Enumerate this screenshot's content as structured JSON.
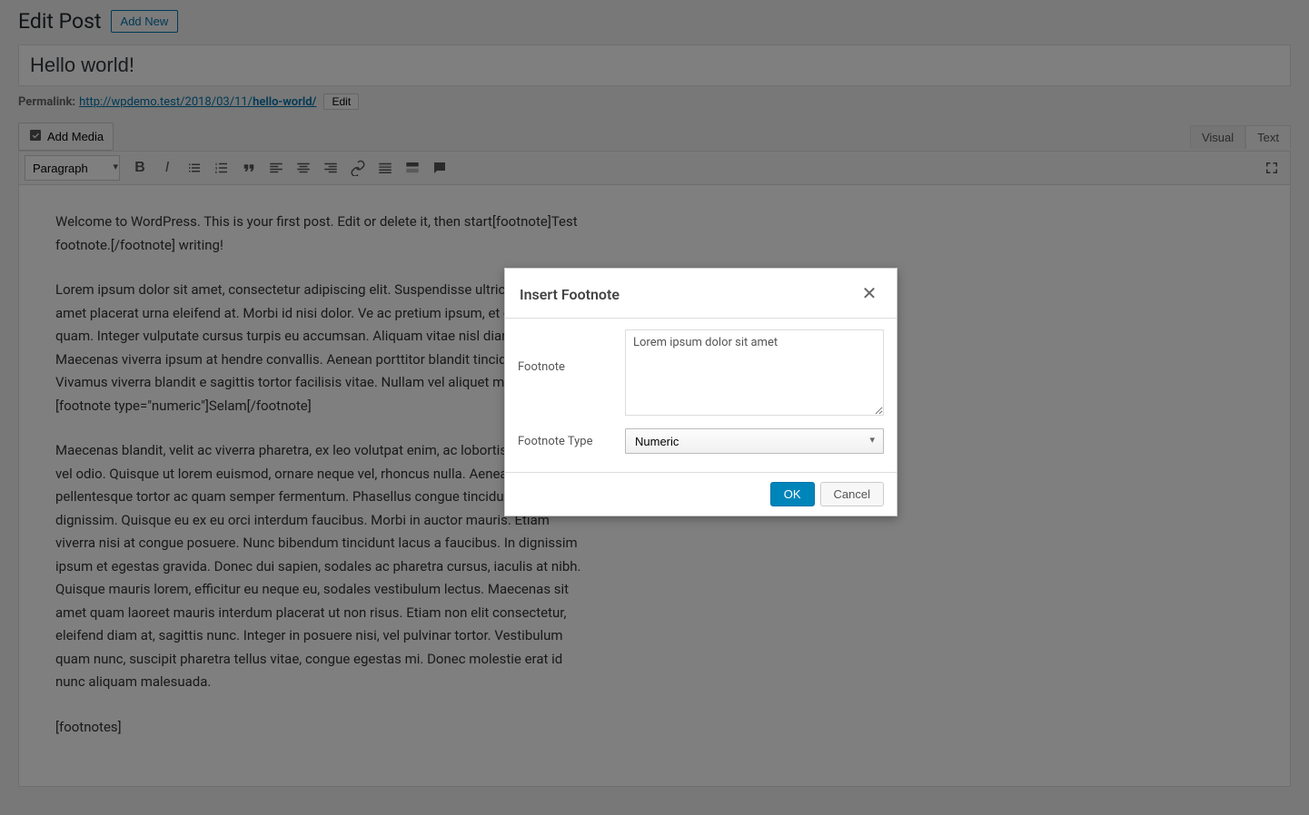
{
  "header": {
    "page_title": "Edit Post",
    "add_new_label": "Add New"
  },
  "post": {
    "title": "Hello world!",
    "permalink_label": "Permalink:",
    "permalink_base": "http://wpdemo.test/2018/03/11/",
    "permalink_slug": "hello-world/",
    "permalink_edit_label": "Edit"
  },
  "media": {
    "add_media_label": "Add Media"
  },
  "tabs": {
    "visual": "Visual",
    "text": "Text"
  },
  "toolbar": {
    "format_selected": "Paragraph"
  },
  "editor": {
    "p1": "Welcome to WordPress. This is your first post. Edit or delete it, then start[footnote]Test footnote.[/footnote] writing!",
    "p2": "Lorem ipsum dolor sit amet, consectetur adipiscing elit. Suspendisse ultrices lacus, sit amet placerat urna eleifend at. Morbi id nisi dolor. Ve ac pretium ipsum, et ornare quam. Integer vulputate cursus turpis eu accumsan. Aliquam vitae nisl diam. Maecenas viverra ipsum at hendre convallis. Aenean porttitor blandit tincidunt. Vivamus viverra blandit e sagittis tortor facilisis vitae. Nullam vel aliquet magna.[footnote type=\"numeric\"]Selam[/footnote]",
    "p3": "Maecenas blandit, velit ac viverra pharetra, ex leo volutpat enim, ac lobortis erat nunc vel odio. Quisque ut lorem euismod, ornare neque vel, rhoncus nulla. Aenean pellentesque tortor ac quam semper fermentum. Phasellus congue tincidunt ligula ut dignissim. Quisque eu ex eu orci interdum faucibus. Morbi in auctor mauris. Etiam viverra nisi at congue posuere. Nunc bibendum tincidunt lacus a faucibus. In dignissim ipsum et egestas gravida. Donec dui sapien, sodales ac pharetra cursus, iaculis at nibh. Quisque mauris lorem, efficitur eu neque eu, sodales vestibulum lectus. Maecenas sit amet quam laoreet mauris interdum placerat ut non risus. Etiam non elit consectetur, eleifend diam at, sagittis nunc. Integer in posuere nisi, vel pulvinar tortor. Vestibulum quam nunc, suscipit pharetra tellus vitae, congue egestas mi. Donec molestie erat id nunc aliquam malesuada.",
    "p4": "[footnotes]"
  },
  "modal": {
    "title": "Insert Footnote",
    "footnote_label": "Footnote",
    "footnote_value": "Lorem ipsum dolor sit amet",
    "type_label": "Footnote Type",
    "type_selected": "Numeric",
    "ok_label": "OK",
    "cancel_label": "Cancel"
  }
}
